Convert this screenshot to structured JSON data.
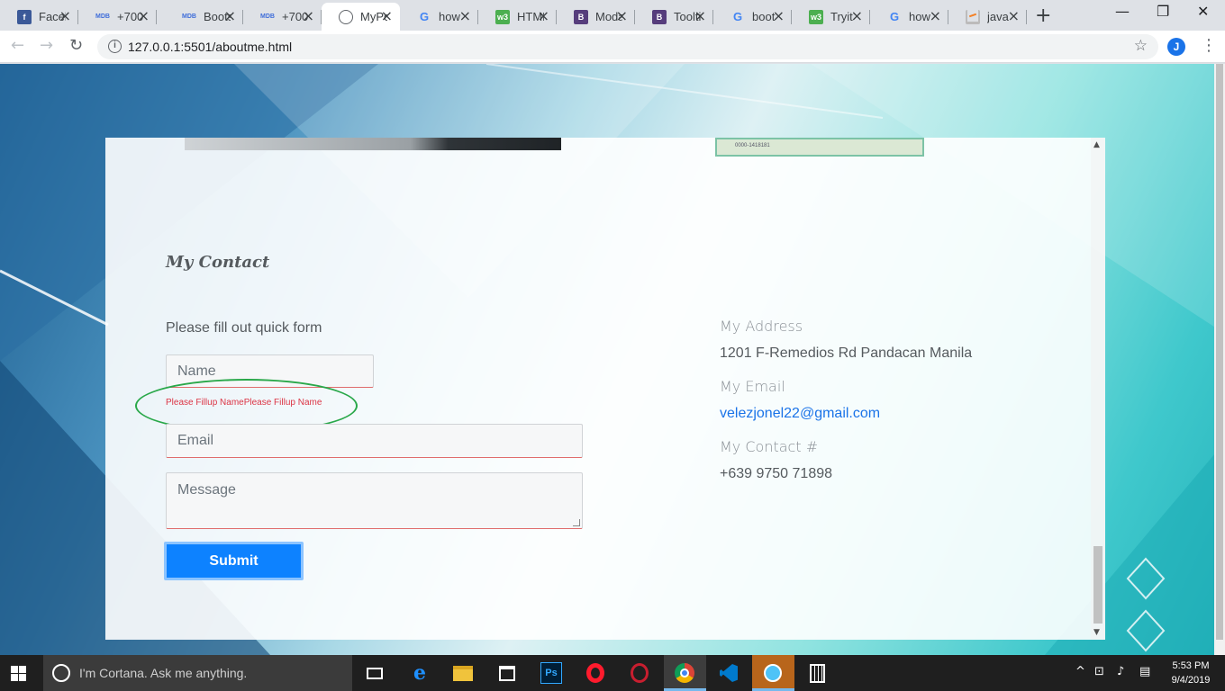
{
  "browser": {
    "tabs": [
      {
        "title": "Facebook",
        "favicon": "facebook-icon",
        "color": "#3b5998",
        "glyph": "f"
      },
      {
        "title": "+700",
        "favicon": "mdb-icon",
        "color": "#ffffff",
        "glyph": "MDB"
      },
      {
        "title": "Bootstrap",
        "favicon": "mdb-icon",
        "color": "#ffffff",
        "glyph": "MDB"
      },
      {
        "title": "+700",
        "favicon": "mdb-icon",
        "color": "#ffffff",
        "glyph": "MDB"
      },
      {
        "title": "MyPortfolio",
        "favicon": "globe-icon",
        "color": "#5f6368",
        "glyph": ""
      },
      {
        "title": "how",
        "favicon": "google-icon",
        "color": "#ffffff",
        "glyph": "G"
      },
      {
        "title": "HTML",
        "favicon": "w3schools-icon",
        "color": "#4caf50",
        "glyph": "w3"
      },
      {
        "title": "Modal",
        "favicon": "bootstrap-icon",
        "color": "#563d7c",
        "glyph": "B"
      },
      {
        "title": "Tooltip",
        "favicon": "bootstrap-icon",
        "color": "#563d7c",
        "glyph": "B"
      },
      {
        "title": "boot",
        "favicon": "google-icon",
        "color": "#ffffff",
        "glyph": "G"
      },
      {
        "title": "Tryit",
        "favicon": "w3schools-icon",
        "color": "#4caf50",
        "glyph": "w3"
      },
      {
        "title": "how",
        "favicon": "google-icon",
        "color": "#ffffff",
        "glyph": "G"
      },
      {
        "title": "java",
        "favicon": "stackoverflow-icon",
        "color": "#f48024",
        "glyph": ""
      }
    ],
    "active_tab": 4,
    "url": "127.0.0.1:5501/aboutme.html",
    "profile_initial": "J"
  },
  "page": {
    "contact_title": "My Contact",
    "form_intro": "Please fill out quick form",
    "form": {
      "name_placeholder": "Name",
      "name_error": "Please Fillup NamePlease Fillup Name",
      "email_placeholder": "Email",
      "message_placeholder": "Message",
      "submit_label": "Submit"
    },
    "address_label": "My Address",
    "address_value": "1201 F-Remedios Rd Pandacan Manila",
    "email_label": "My Email",
    "email_value": "velezjonel22@gmail.com",
    "phone_label": "My Contact #",
    "phone_value": "+639 9750 71898",
    "certificate_text": "0000-1418181"
  },
  "taskbar": {
    "cortana_placeholder": "I'm Cortana. Ask me anything.",
    "time": "5:53 PM",
    "date": "9/4/2019",
    "pinned": [
      "task-view-icon",
      "edge-icon",
      "file-explorer-icon",
      "store-icon",
      "photoshop-icon",
      "opera-icon",
      "opera-gx-icon",
      "chrome-icon",
      "vscode-icon",
      "app-icon",
      "calculator-icon"
    ]
  },
  "colors": {
    "accent_button": "#0d82ff",
    "error_text": "#dc3545",
    "annotation_circle": "#2aa84a",
    "link": "#1a73e8"
  }
}
